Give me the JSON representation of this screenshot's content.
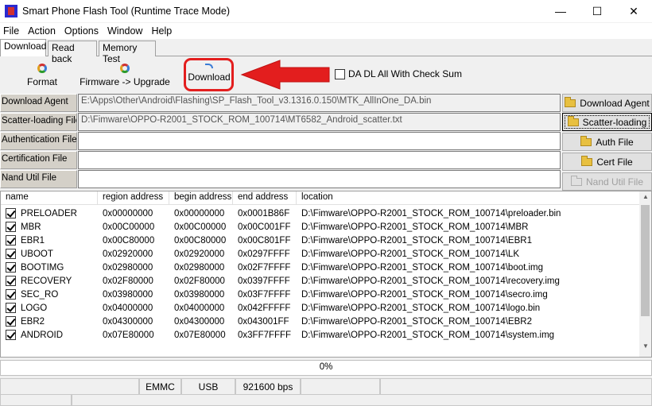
{
  "window": {
    "title": "Smart Phone Flash Tool (Runtime Trace Mode)",
    "minimize": "—",
    "maximize": "☐",
    "close": "✕"
  },
  "menu": [
    "File",
    "Action",
    "Options",
    "Window",
    "Help"
  ],
  "tabs": [
    "Download",
    "Read back",
    "Memory Test"
  ],
  "toolbar": {
    "format": "Format",
    "firmware_upgrade": "Firmware -> Upgrade",
    "download": "Download",
    "da_dl_checksum": "DA DL All With Check Sum"
  },
  "form": {
    "download_agent": {
      "label": "Download Agent",
      "value": "E:\\Apps\\Other\\Android\\Flashing\\SP_Flash_Tool_v3.1316.0.150\\MTK_AllInOne_DA.bin"
    },
    "scatter": {
      "label": "Scatter-loading File",
      "value": "D:\\Fimware\\OPPO-R2001_STOCK_ROM_100714\\MT6582_Android_scatter.txt"
    },
    "auth": {
      "label": "Authentication File",
      "value": ""
    },
    "cert": {
      "label": "Certification File",
      "value": ""
    },
    "nand": {
      "label": "Nand Util File",
      "value": ""
    }
  },
  "side_buttons": {
    "download_agent": "Download Agent",
    "scatter": "Scatter-loading",
    "auth": "Auth File",
    "cert": "Cert File",
    "nand": "Nand Util File"
  },
  "table": {
    "headers": [
      "name",
      "region address",
      "begin address",
      "end address",
      "location"
    ],
    "rows": [
      {
        "name": "PRELOADER",
        "region": "0x00000000",
        "begin": "0x00000000",
        "end": "0x0001B86F",
        "location": "D:\\Fimware\\OPPO-R2001_STOCK_ROM_100714\\preloader.bin"
      },
      {
        "name": "MBR",
        "region": "0x00C00000",
        "begin": "0x00C00000",
        "end": "0x00C001FF",
        "location": "D:\\Fimware\\OPPO-R2001_STOCK_ROM_100714\\MBR"
      },
      {
        "name": "EBR1",
        "region": "0x00C80000",
        "begin": "0x00C80000",
        "end": "0x00C801FF",
        "location": "D:\\Fimware\\OPPO-R2001_STOCK_ROM_100714\\EBR1"
      },
      {
        "name": "UBOOT",
        "region": "0x02920000",
        "begin": "0x02920000",
        "end": "0x0297FFFF",
        "location": "D:\\Fimware\\OPPO-R2001_STOCK_ROM_100714\\LK"
      },
      {
        "name": "BOOTIMG",
        "region": "0x02980000",
        "begin": "0x02980000",
        "end": "0x02F7FFFF",
        "location": "D:\\Fimware\\OPPO-R2001_STOCK_ROM_100714\\boot.img"
      },
      {
        "name": "RECOVERY",
        "region": "0x02F80000",
        "begin": "0x02F80000",
        "end": "0x0397FFFF",
        "location": "D:\\Fimware\\OPPO-R2001_STOCK_ROM_100714\\recovery.img"
      },
      {
        "name": "SEC_RO",
        "region": "0x03980000",
        "begin": "0x03980000",
        "end": "0x03F7FFFF",
        "location": "D:\\Fimware\\OPPO-R2001_STOCK_ROM_100714\\secro.img"
      },
      {
        "name": "LOGO",
        "region": "0x04000000",
        "begin": "0x04000000",
        "end": "0x042FFFFF",
        "location": "D:\\Fimware\\OPPO-R2001_STOCK_ROM_100714\\logo.bin"
      },
      {
        "name": "EBR2",
        "region": "0x04300000",
        "begin": "0x04300000",
        "end": "0x043001FF",
        "location": "D:\\Fimware\\OPPO-R2001_STOCK_ROM_100714\\EBR2"
      },
      {
        "name": "ANDROID",
        "region": "0x07E80000",
        "begin": "0x07E80000",
        "end": "0x3FF7FFFF",
        "location": "D:\\Fimware\\OPPO-R2001_STOCK_ROM_100714\\system.img"
      }
    ]
  },
  "progress": "0%",
  "status": {
    "storage": "EMMC",
    "connection": "USB",
    "baud": "921600 bps"
  },
  "colors": {
    "highlight": "#e31e1e"
  }
}
